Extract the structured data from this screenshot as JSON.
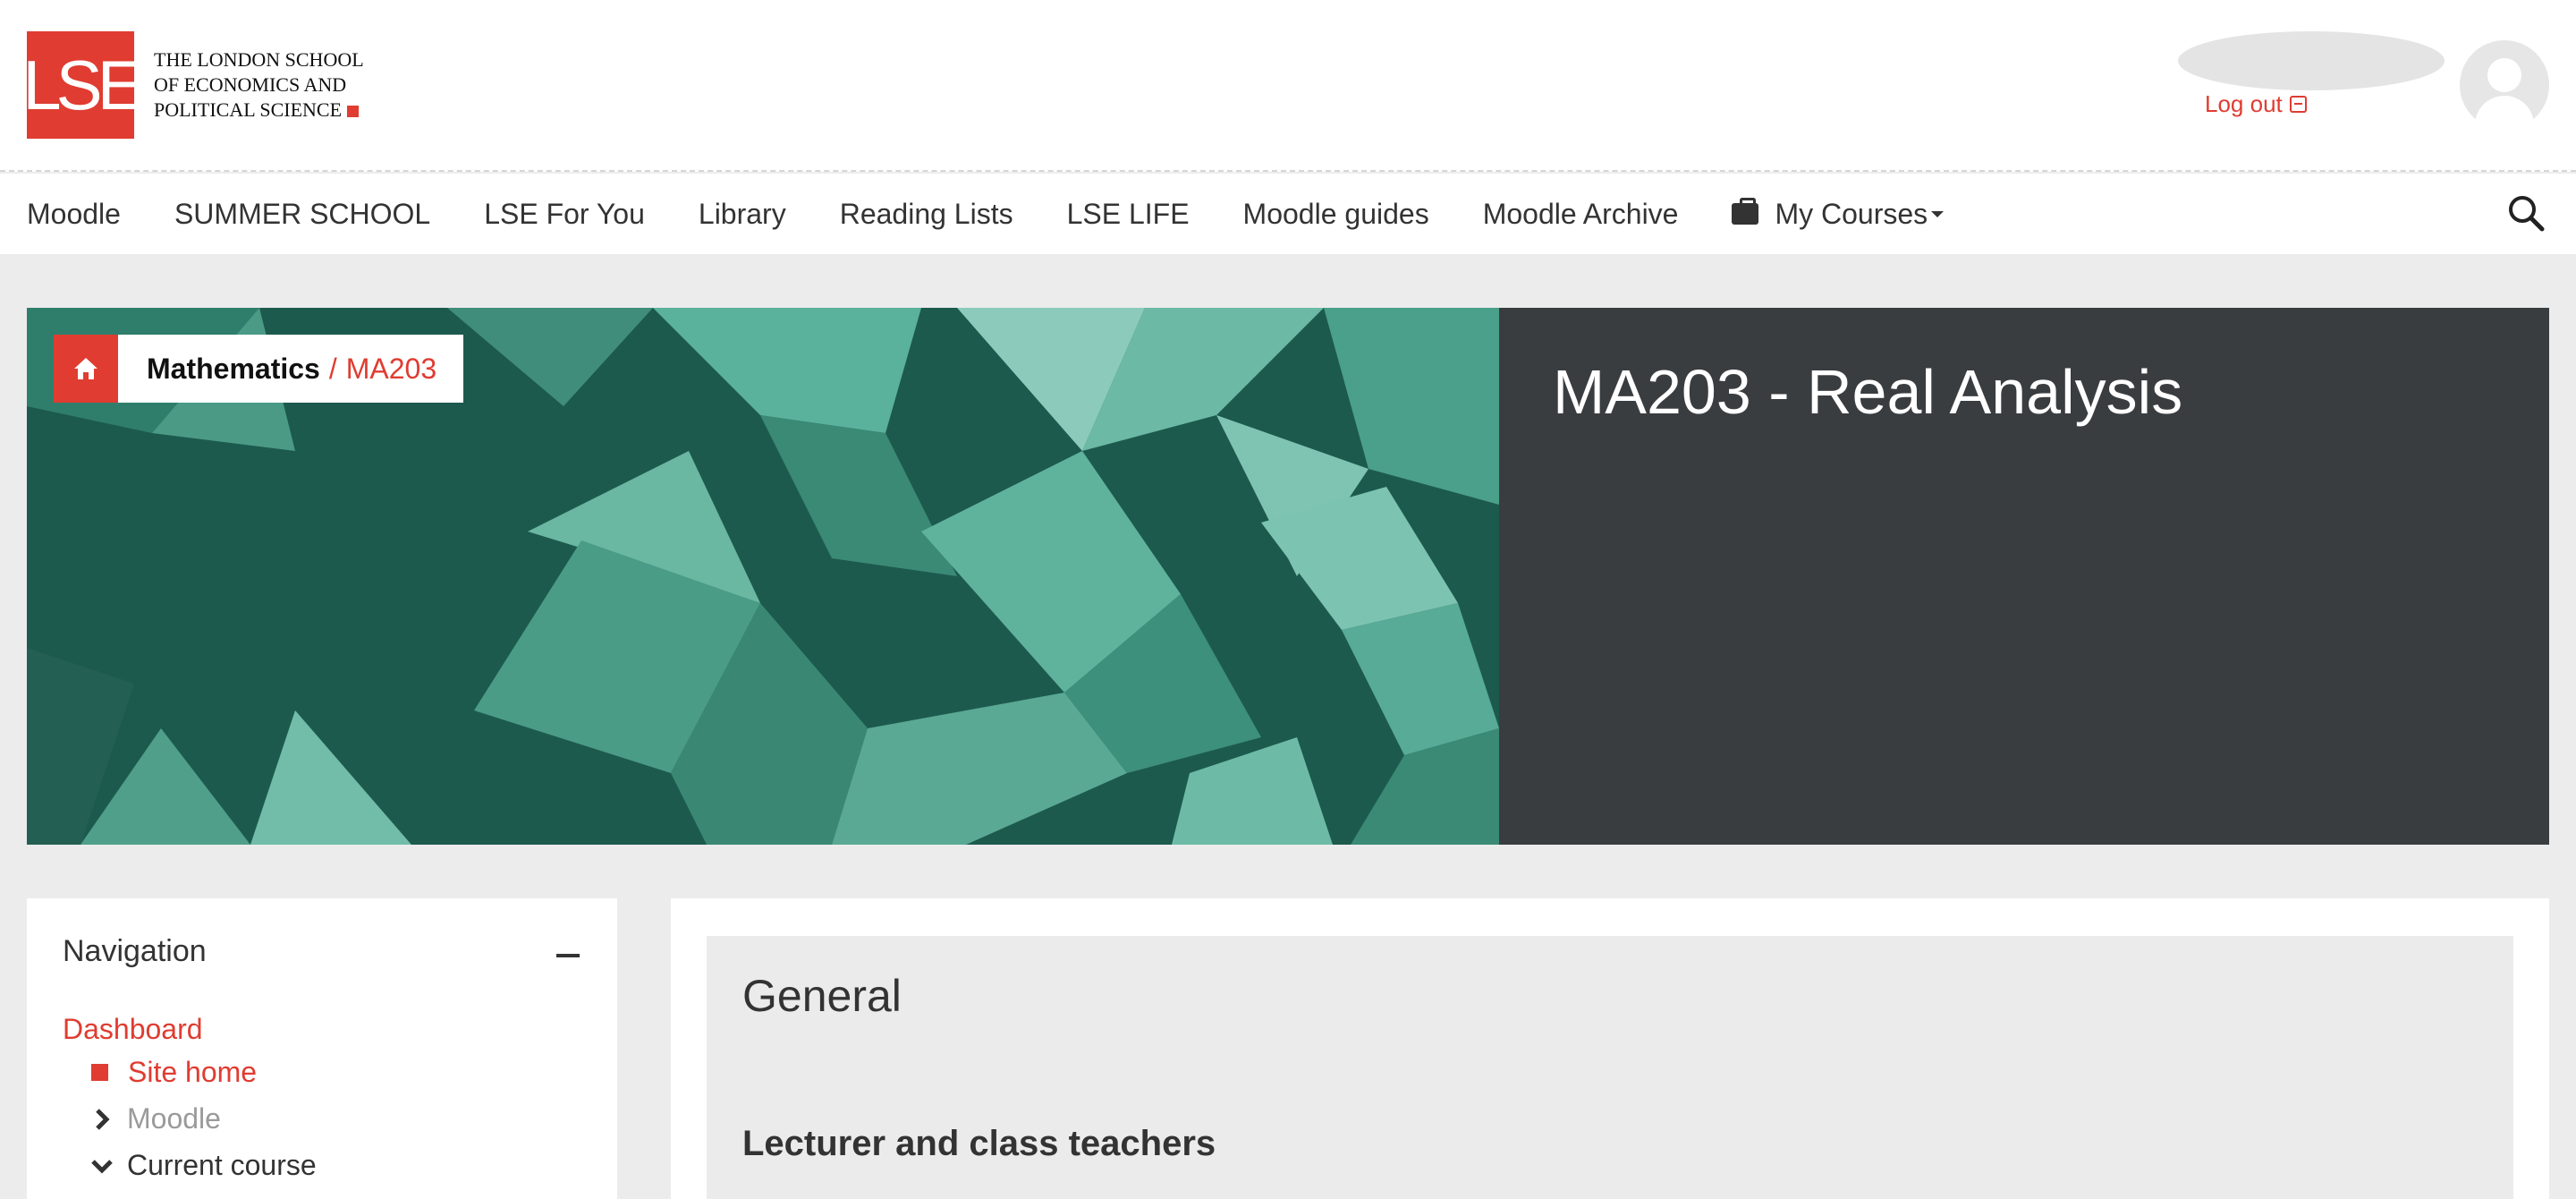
{
  "header": {
    "logo_mark": "LSE",
    "logo_lines": [
      "THE LONDON SCHOOL",
      "OF ECONOMICS AND",
      "POLITICAL SCIENCE"
    ],
    "logout_label": "Log out",
    "avatar_icon": "user-avatar-icon"
  },
  "nav": {
    "items": [
      {
        "label": "Moodle"
      },
      {
        "label": "SUMMER SCHOOL"
      },
      {
        "label": "LSE For You"
      },
      {
        "label": "Library"
      },
      {
        "label": "Reading Lists"
      },
      {
        "label": "LSE LIFE"
      },
      {
        "label": "Moodle guides"
      },
      {
        "label": "Moodle Archive"
      }
    ],
    "my_courses_label": "My Courses",
    "my_courses_icon": "briefcase-icon",
    "search_icon": "search-icon"
  },
  "banner": {
    "breadcrumb": {
      "home_icon": "home-icon",
      "category": "Mathematics",
      "separator": "/",
      "current": "MA203"
    },
    "course_title": "MA203 - Real Analysis"
  },
  "navigation_block": {
    "title": "Navigation",
    "dashboard": "Dashboard",
    "items": [
      {
        "label": "Site home",
        "icon": "square-bullet-icon"
      },
      {
        "label": "Moodle",
        "icon": "chevron-right-icon"
      },
      {
        "label": "Current course",
        "icon": "chevron-down-icon"
      }
    ]
  },
  "main": {
    "section_title": "General",
    "section_subtitle": "Lecturer and class teachers"
  },
  "colors": {
    "brand_red": "#e03c31",
    "banner_dark": "#3a3d40",
    "banner_teal": "#1e5b4f",
    "page_bg": "#ececec"
  }
}
